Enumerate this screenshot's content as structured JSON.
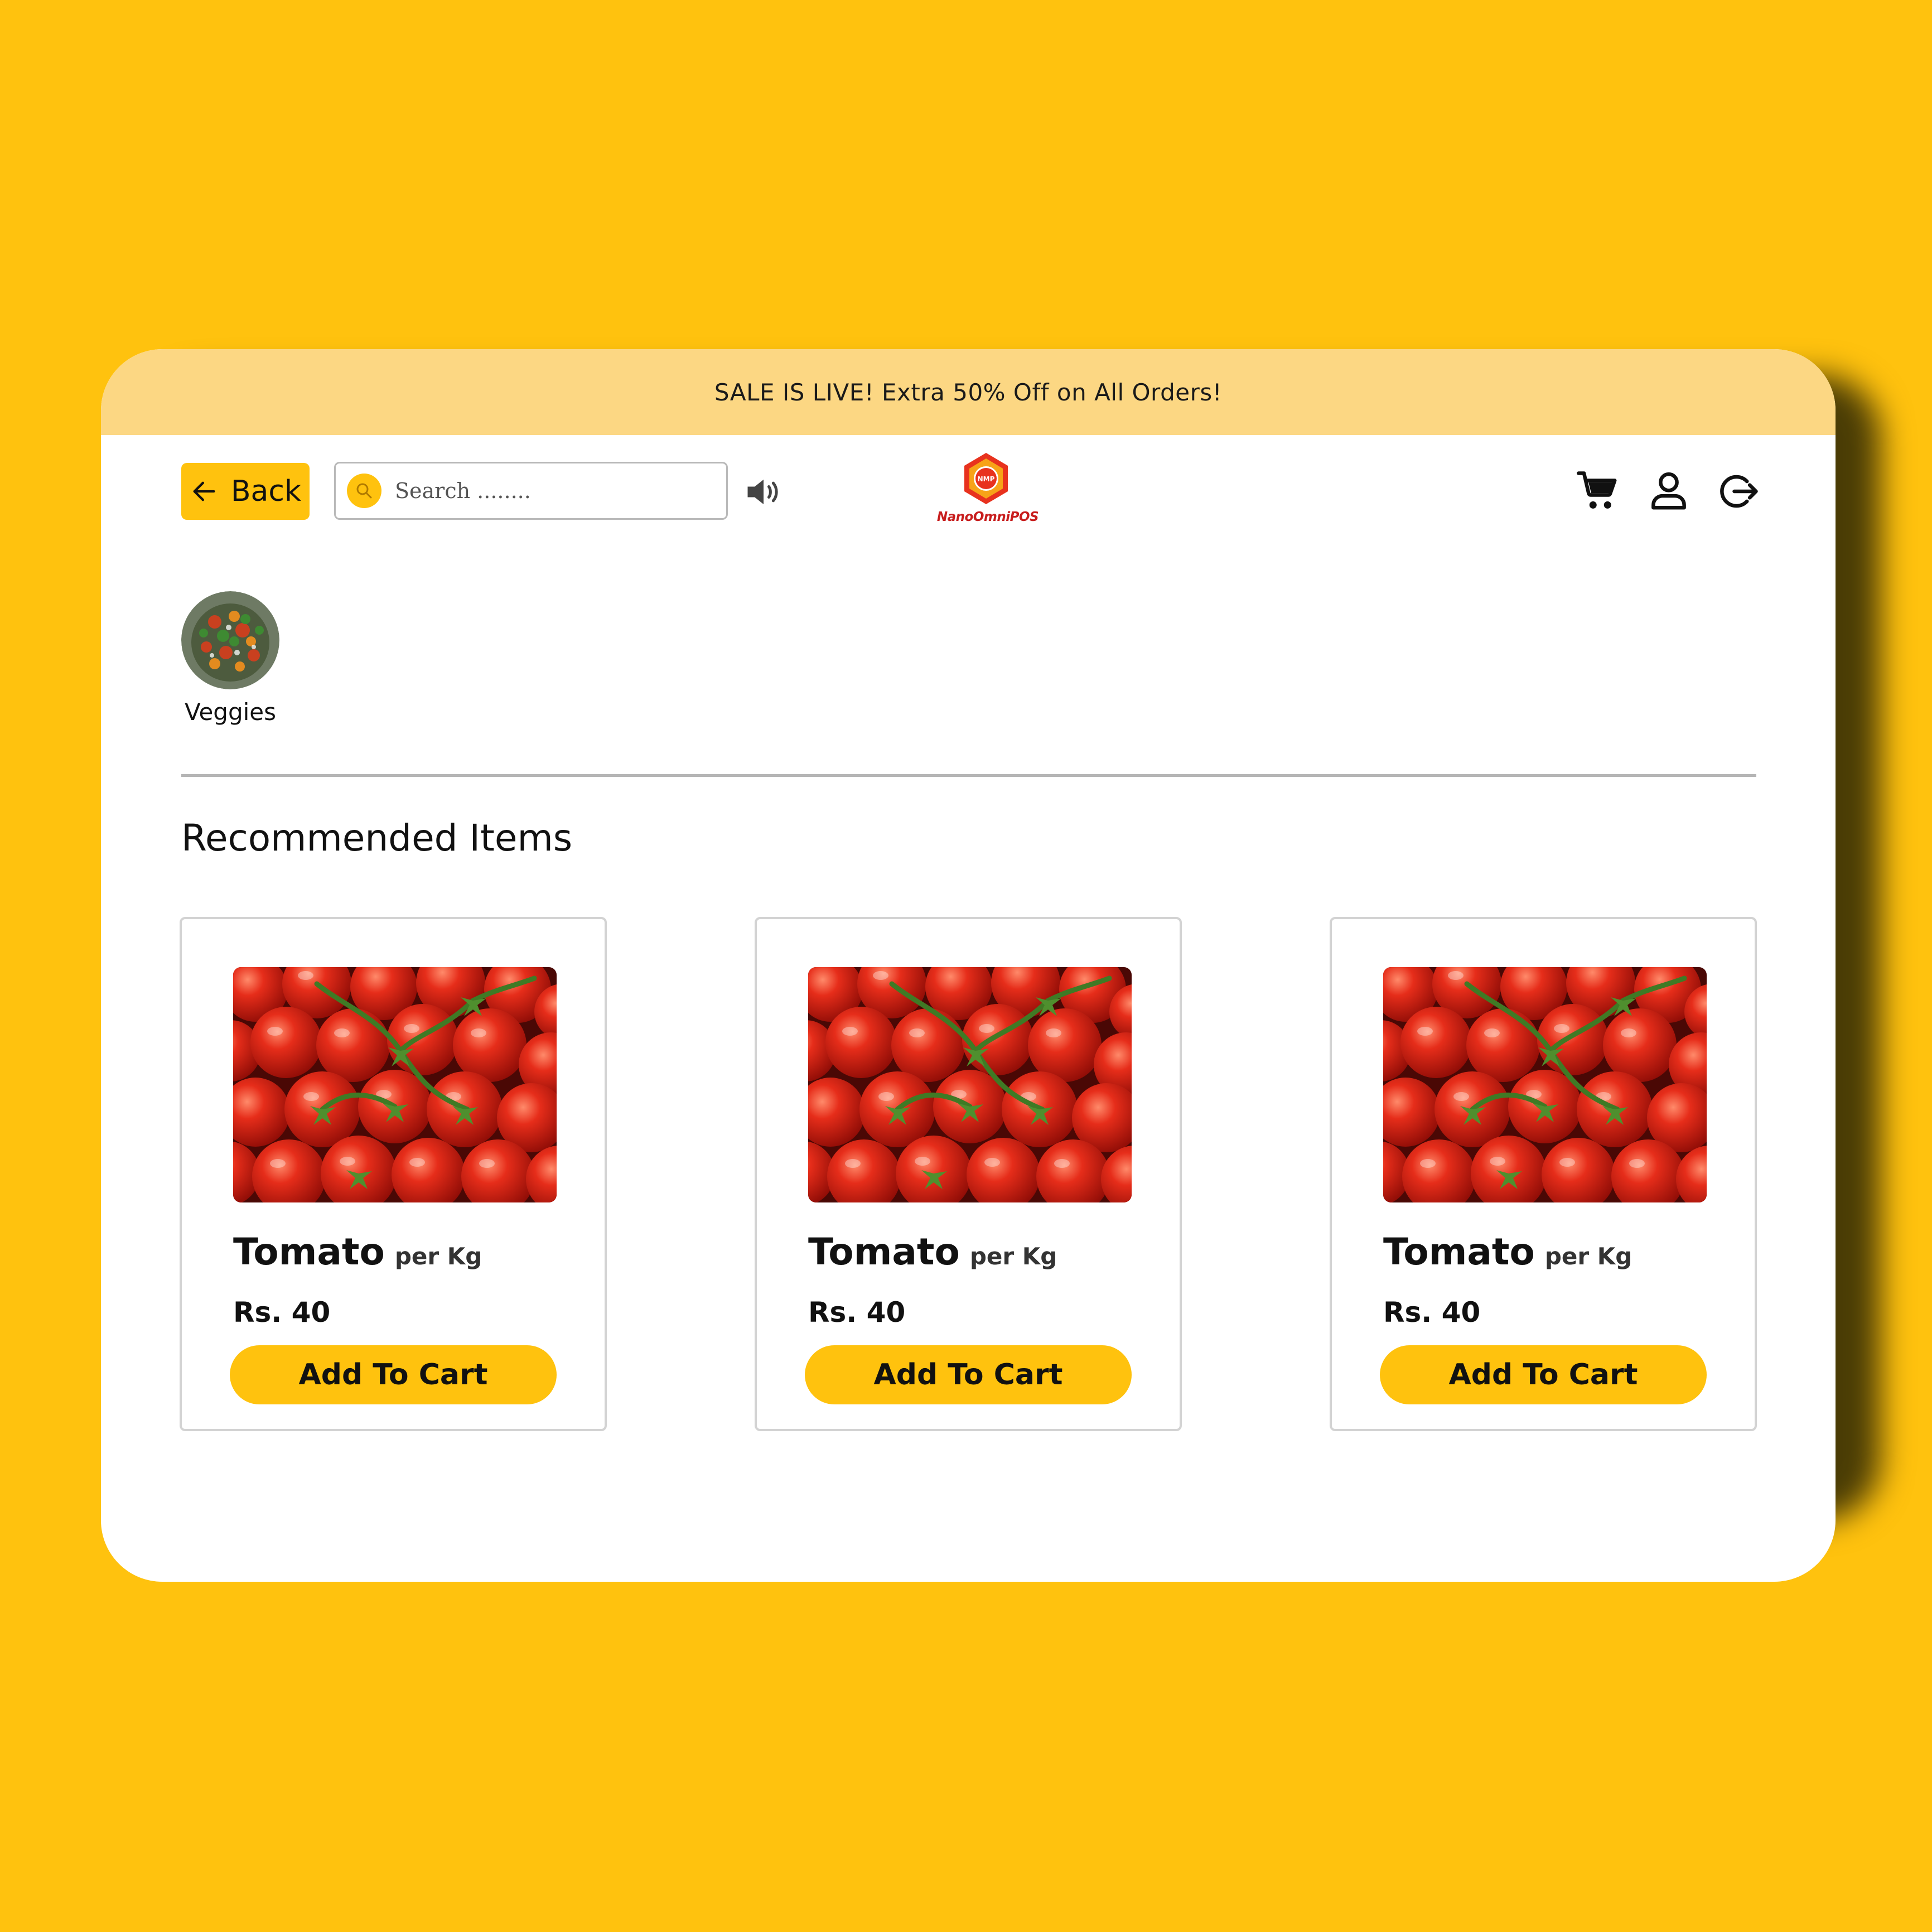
{
  "banner": {
    "text": "SALE IS LIVE! Extra 50% Off on All Orders!"
  },
  "header": {
    "back_label": "Back",
    "search_placeholder": "Search ........",
    "logo_badge": "NMP",
    "logo_text": "NanoOmniPOS"
  },
  "categories": [
    {
      "label": "Veggies"
    }
  ],
  "section": {
    "title": "Recommended Items"
  },
  "products": [
    {
      "name": "Tomato",
      "unit": "per Kg",
      "price": "Rs. 40",
      "button": "Add To Cart"
    },
    {
      "name": "Tomato",
      "unit": "per Kg",
      "price": "Rs. 40",
      "button": "Add To Cart"
    },
    {
      "name": "Tomato",
      "unit": "per Kg",
      "price": "Rs. 40",
      "button": "Add To Cart"
    }
  ],
  "colors": {
    "background": "#FFC20E",
    "banner": "#FCD783",
    "accent": "#FFC20E",
    "logo_red": "#C81E1E"
  },
  "icons": [
    "arrow-left-icon",
    "search-icon",
    "speaker-icon",
    "cart-icon",
    "user-icon",
    "logout-icon"
  ]
}
